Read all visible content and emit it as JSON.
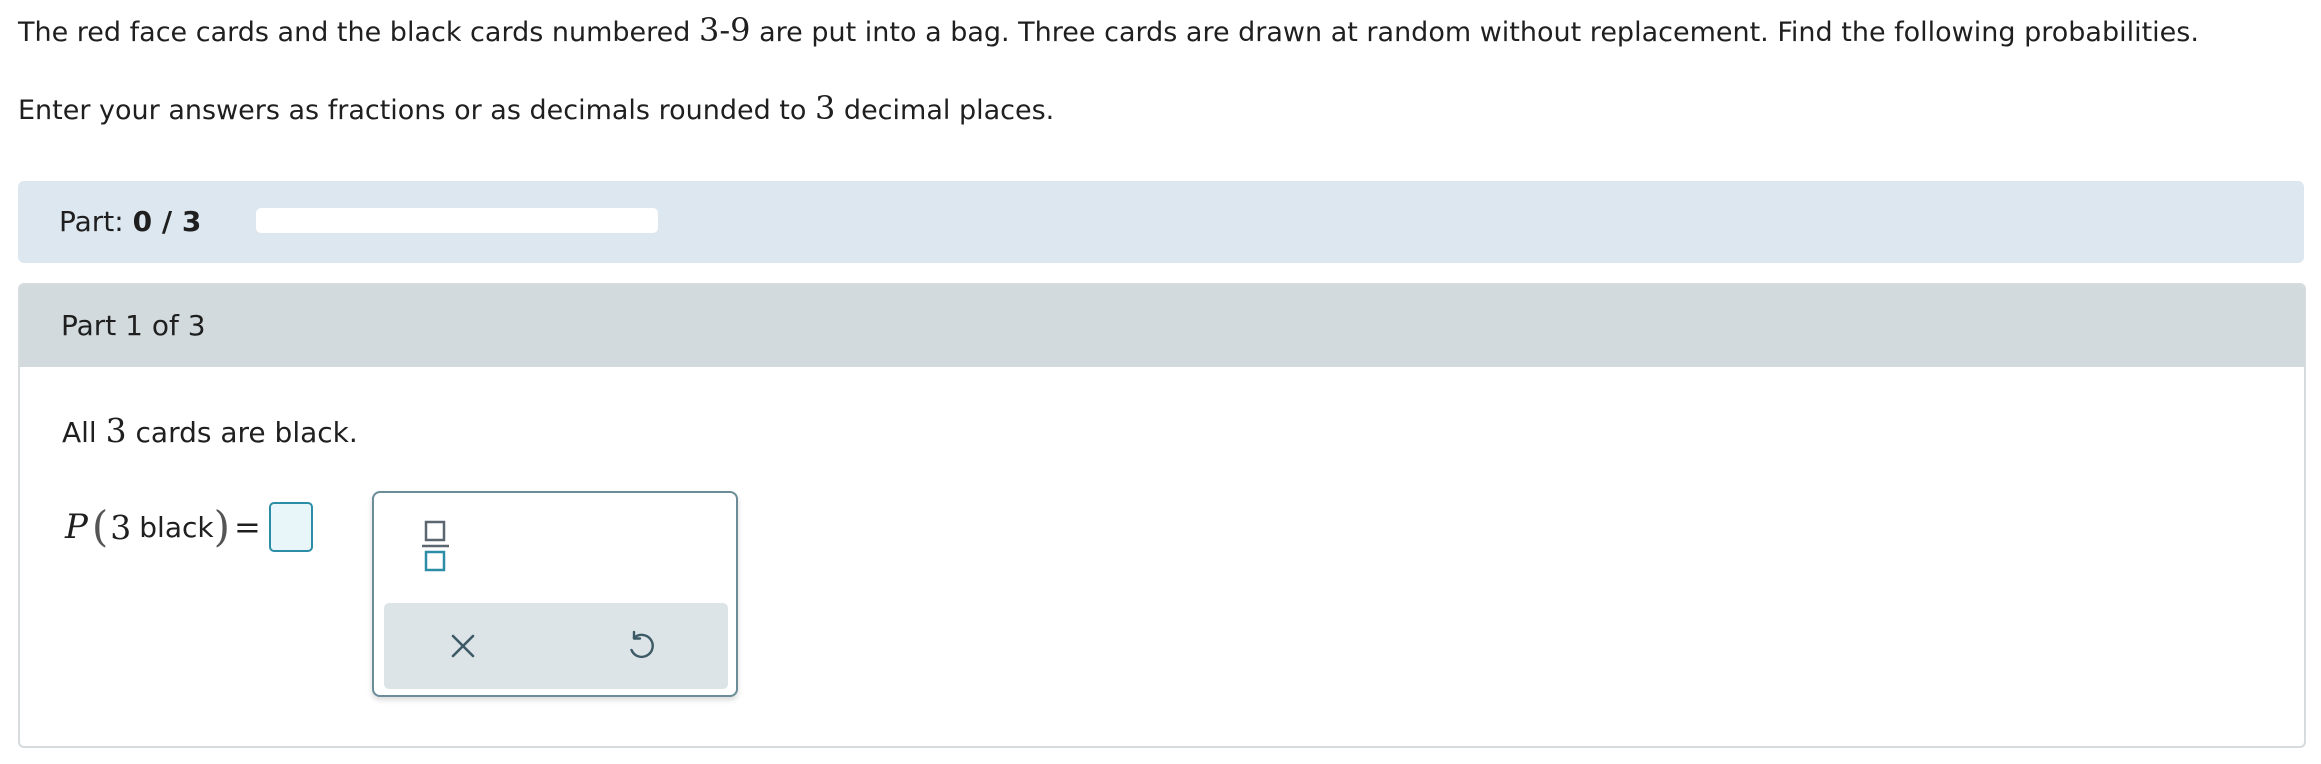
{
  "intro": {
    "line1_before": "The red face cards and the black cards numbered ",
    "line1_range": "3-9",
    "line1_after": " are put into a bag. Three cards are drawn at random without replacement. Find the following probabilities.",
    "line2_before": "Enter your answers as fractions or as decimals rounded to ",
    "line2_number": "3",
    "line2_after": " decimal places."
  },
  "progress": {
    "label": "Part: ",
    "value": "0 / 3",
    "completed_fraction": 0
  },
  "part": {
    "header": "Part 1 of 3",
    "question_before": "All ",
    "question_number": "3",
    "question_after": " cards are black.",
    "formula": {
      "function": "P",
      "open_paren": "(",
      "count": "3",
      "word": "black",
      "close_paren": ")",
      "equals": "=",
      "answer_value": ""
    }
  },
  "palette": {
    "fraction_icon": "fraction-template-icon",
    "clear_icon": "close-icon",
    "reset_icon": "undo-icon"
  },
  "colors": {
    "accent": "#2c8da6",
    "progress_bar_bg": "#dce7ef",
    "panel_header_bg": "#d2dadd",
    "answer_box_fill": "#e9f6f9"
  }
}
